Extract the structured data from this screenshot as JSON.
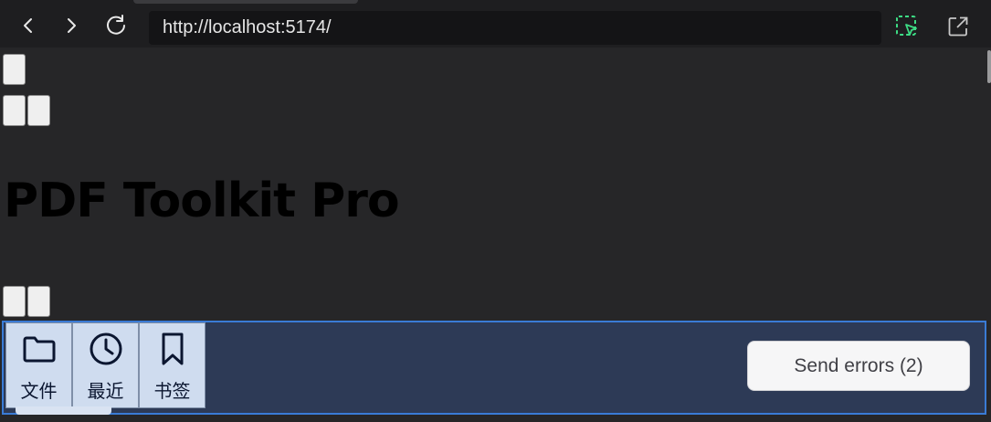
{
  "browser": {
    "url": "http://localhost:5174/",
    "nav_icons": [
      "back-icon",
      "forward-icon",
      "reload-icon"
    ],
    "tool_icons": [
      "select-element-icon",
      "open-external-icon"
    ],
    "accent_color": "#3ddc84"
  },
  "app": {
    "title": "PDF Toolkit Pro"
  },
  "bookmark_bar": {
    "items": [
      {
        "icon": "folder-icon",
        "label": "文件"
      },
      {
        "icon": "clock-icon",
        "label": "最近"
      },
      {
        "icon": "bookmark-icon",
        "label": "书签"
      }
    ]
  },
  "error_button": {
    "label": "Send errors (2)"
  },
  "colors": {
    "panel_bg": "#2d3a56",
    "panel_border": "#3a7bd5",
    "bookmark_bg": "#cfdcef"
  }
}
